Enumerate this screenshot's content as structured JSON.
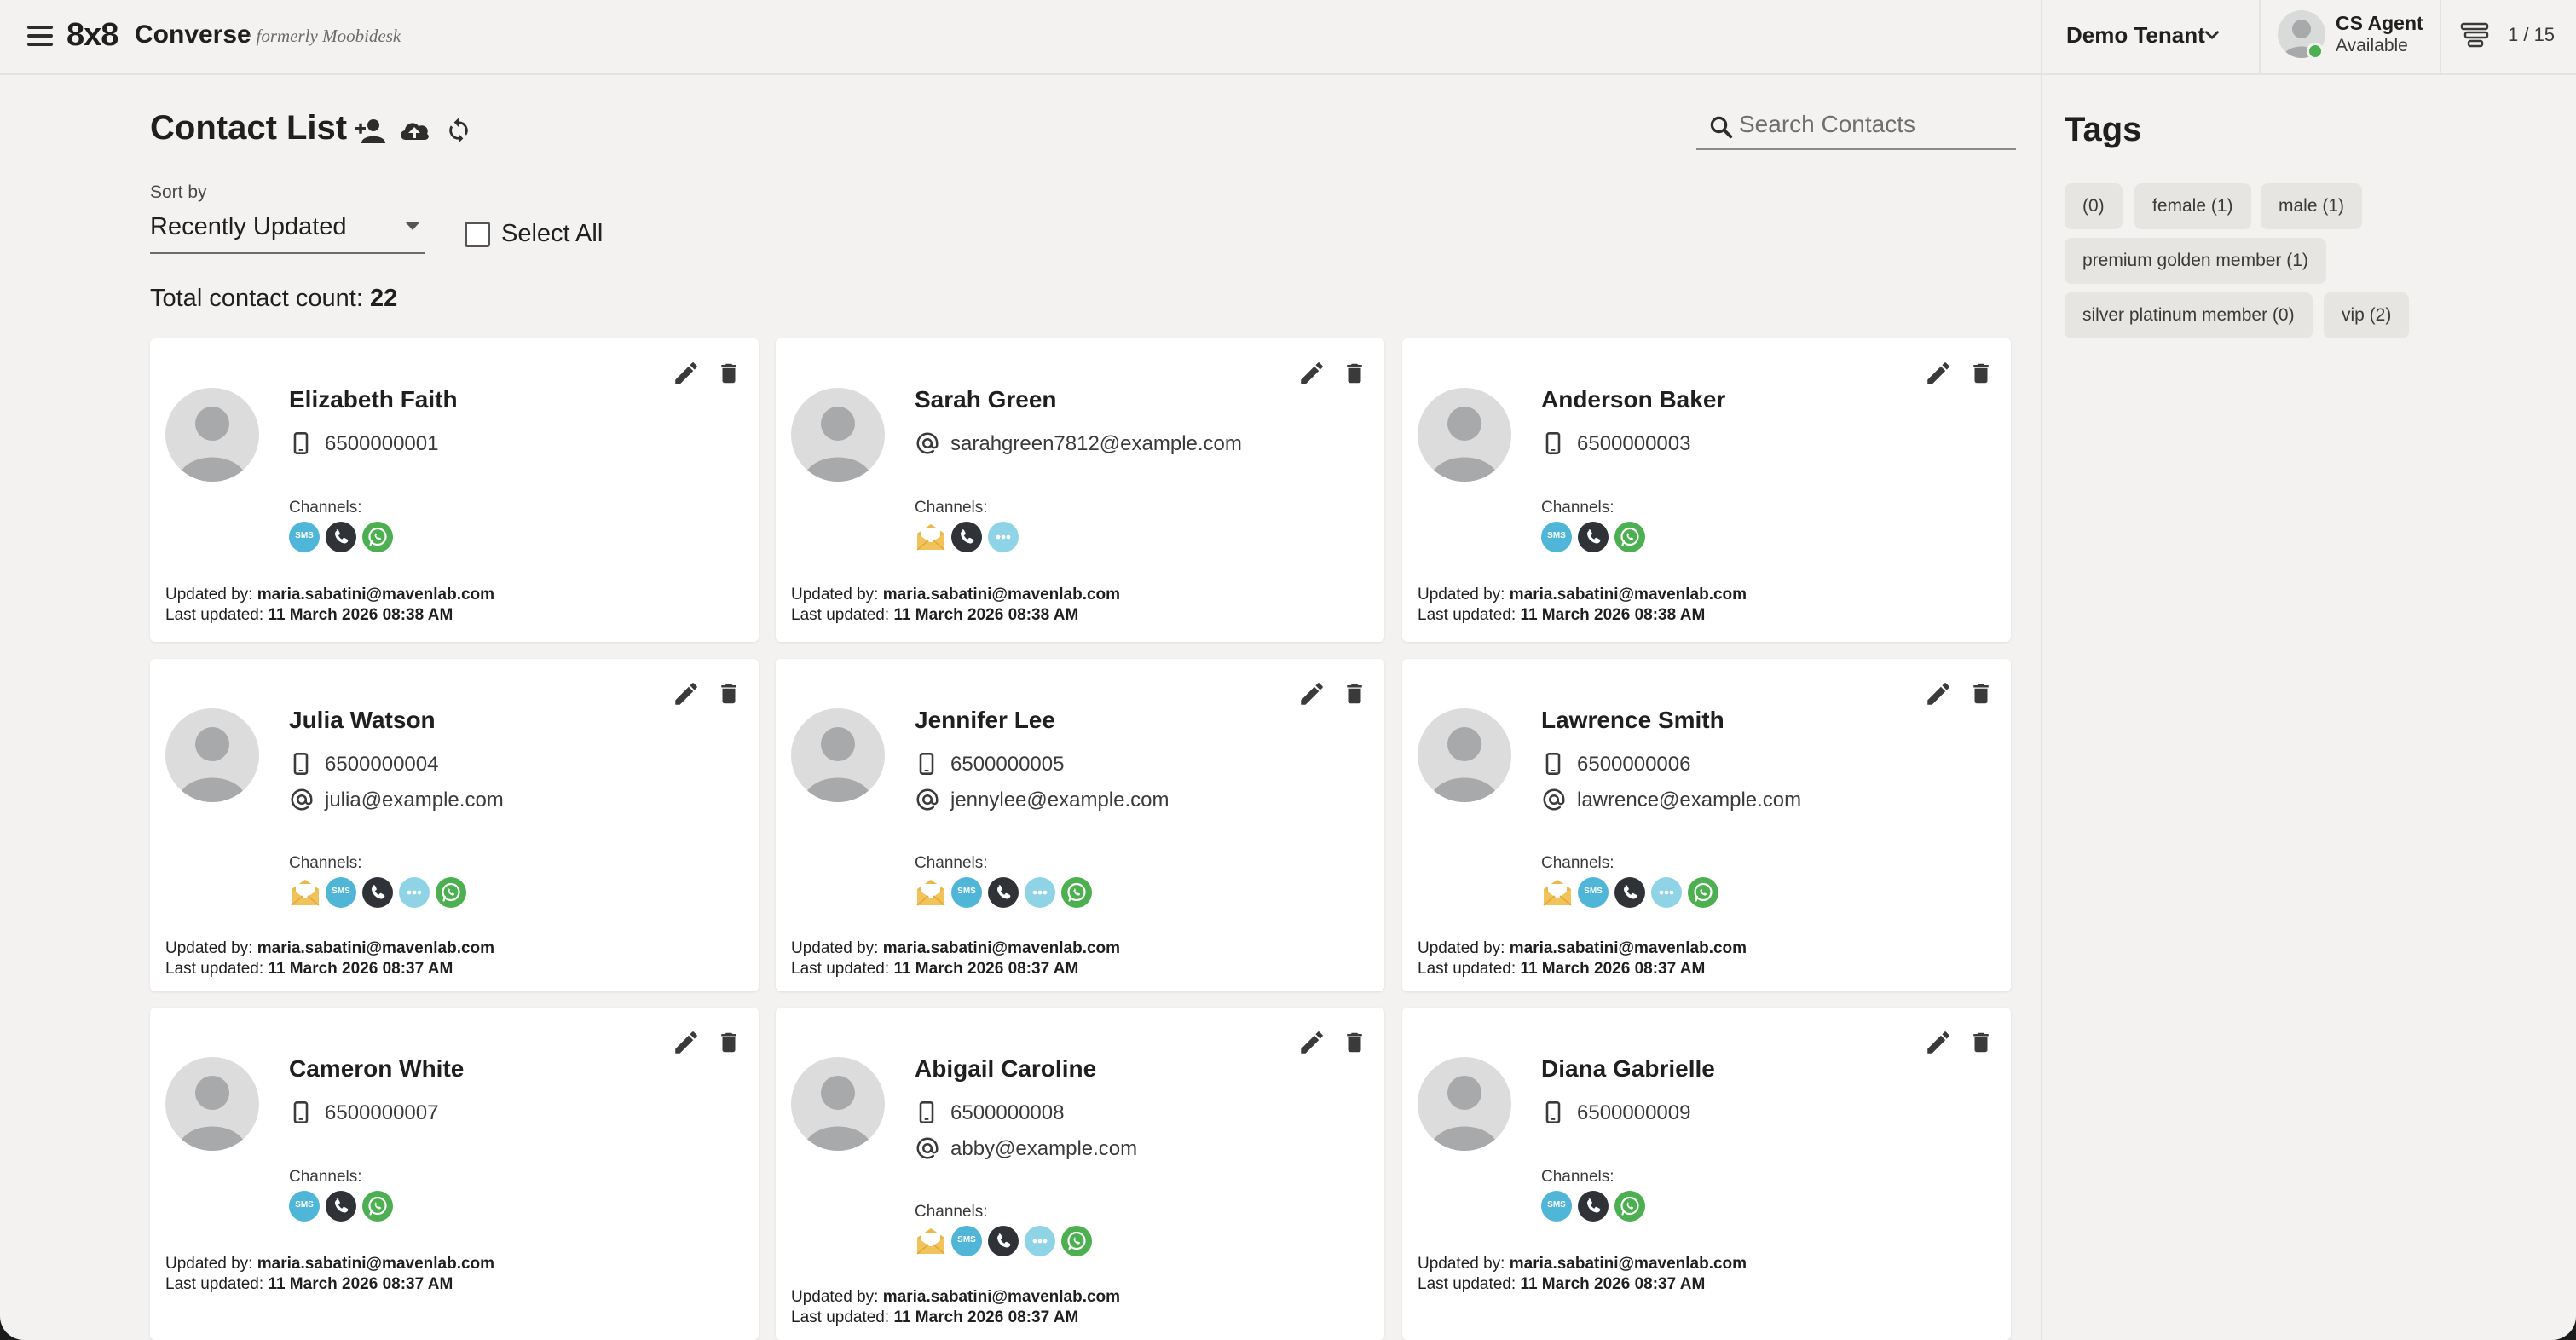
{
  "header": {
    "logo": "8x8",
    "app_name": "Converse",
    "formerly": "· formerly Moobidesk",
    "tenant": "Demo Tenant",
    "agent_name": "CS Agent",
    "agent_status": "Available",
    "queue_count": "1 / 15"
  },
  "main": {
    "title": "Contact List",
    "search_placeholder": "Search Contacts",
    "sort_label": "Sort by",
    "sort_value": "Recently Updated",
    "select_all": "Select All",
    "total_prefix": "Total contact count:",
    "total_value": "22",
    "channels_label": "Channels:",
    "updated_by_label": "Updated by:",
    "last_updated_label": "Last updated:"
  },
  "contacts": [
    {
      "name": "Elizabeth Faith",
      "phone": "6500000001",
      "email": "",
      "channels": [
        "sms",
        "phone",
        "whatsapp"
      ],
      "updated_by": "maria.sabatini@mavenlab.com",
      "last_updated": "11 March 2026 08:38 AM"
    },
    {
      "name": "Sarah Green",
      "phone": "",
      "email": "sarahgreen7812@example.com",
      "channels": [
        "email",
        "phone",
        "chat"
      ],
      "updated_by": "maria.sabatini@mavenlab.com",
      "last_updated": "11 March 2026 08:38 AM"
    },
    {
      "name": "Anderson Baker",
      "phone": "6500000003",
      "email": "",
      "channels": [
        "sms",
        "phone",
        "whatsapp"
      ],
      "updated_by": "maria.sabatini@mavenlab.com",
      "last_updated": "11 March 2026 08:38 AM"
    },
    {
      "name": "Julia Watson",
      "phone": "6500000004",
      "email": "julia@example.com",
      "channels": [
        "email",
        "sms",
        "phone",
        "chat",
        "whatsapp"
      ],
      "updated_by": "maria.sabatini@mavenlab.com",
      "last_updated": "11 March 2026 08:37 AM"
    },
    {
      "name": "Jennifer Lee",
      "phone": "6500000005",
      "email": "jennylee@example.com",
      "channels": [
        "email",
        "sms",
        "phone",
        "chat",
        "whatsapp"
      ],
      "updated_by": "maria.sabatini@mavenlab.com",
      "last_updated": "11 March 2026 08:37 AM"
    },
    {
      "name": "Lawrence Smith",
      "phone": "6500000006",
      "email": "lawrence@example.com",
      "channels": [
        "email",
        "sms",
        "phone",
        "chat",
        "whatsapp"
      ],
      "updated_by": "maria.sabatini@mavenlab.com",
      "last_updated": "11 March 2026 08:37 AM"
    },
    {
      "name": "Cameron White",
      "phone": "6500000007",
      "email": "",
      "channels": [
        "sms",
        "phone",
        "whatsapp"
      ],
      "updated_by": "maria.sabatini@mavenlab.com",
      "last_updated": "11 March 2026 08:37 AM"
    },
    {
      "name": "Abigail Caroline",
      "phone": "6500000008",
      "email": "abby@example.com",
      "channels": [
        "email",
        "sms",
        "phone",
        "chat",
        "whatsapp"
      ],
      "updated_by": "maria.sabatini@mavenlab.com",
      "last_updated": "11 March 2026 08:37 AM"
    },
    {
      "name": "Diana Gabrielle",
      "phone": "6500000009",
      "email": "",
      "channels": [
        "sms",
        "phone",
        "whatsapp"
      ],
      "updated_by": "maria.sabatini@mavenlab.com",
      "last_updated": "11 March 2026 08:37 AM"
    }
  ],
  "tags": {
    "title": "Tags",
    "items": [
      "(0)",
      "female (1)",
      "male (1)",
      "premium golden member (1)",
      "silver platinum member (0)",
      "vip (2)"
    ]
  },
  "icons": {
    "sms_text": "SMS"
  },
  "colors": {
    "background": "#f3f2f0",
    "card": "#ffffff",
    "status_available": "#4caf50",
    "sms": "#4fb6d8",
    "phone": "#2f3338",
    "whatsapp": "#4caf50",
    "email": "#f2c35a",
    "chat": "#8fd3e6"
  }
}
